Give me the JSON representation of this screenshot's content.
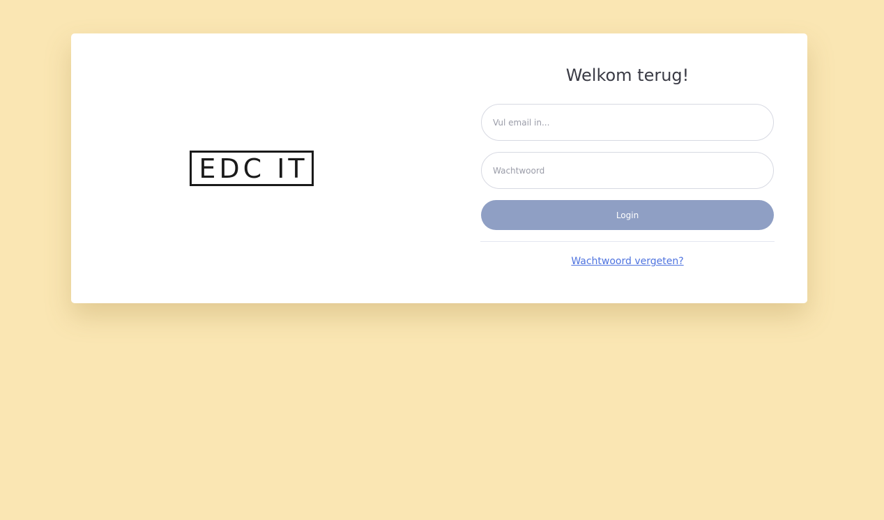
{
  "logo": {
    "text": "EDC IT"
  },
  "login": {
    "title": "Welkom terug!",
    "email_placeholder": "Vul email in...",
    "password_placeholder": "Wachtwoord",
    "login_label": "Login",
    "forgot_label": "Wachtwoord vergeten?"
  },
  "colors": {
    "page_background": "#fae6b3",
    "card_background": "#ffffff",
    "button": "#8f9fc4",
    "link": "#4e73df",
    "title_text": "#3a3b45"
  }
}
